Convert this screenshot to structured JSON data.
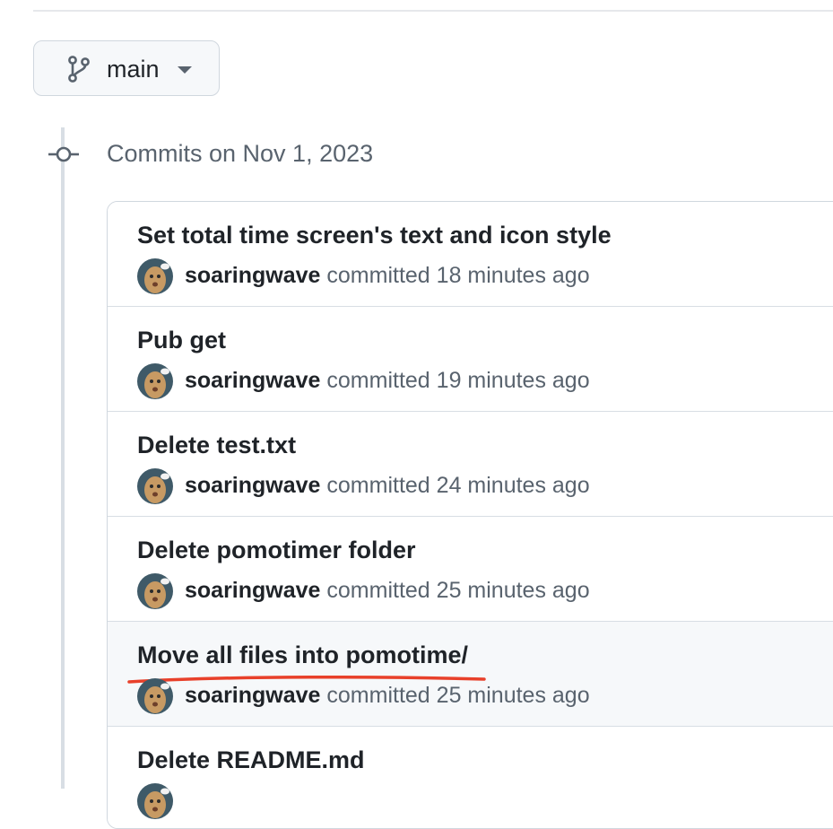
{
  "branch": {
    "name": "main",
    "icon": "git-branch-icon",
    "dropdown_icon": "triangle-down-icon"
  },
  "timeline": {
    "heading": "Commits on Nov 1, 2023",
    "icon": "git-commit-icon"
  },
  "commits": [
    {
      "title": "Set total time screen's text and icon style",
      "author": "soaringwave",
      "action": "committed",
      "time": "18 minutes ago"
    },
    {
      "title": "Pub get",
      "author": "soaringwave",
      "action": "committed",
      "time": "19 minutes ago"
    },
    {
      "title": "Delete test.txt",
      "author": "soaringwave",
      "action": "committed",
      "time": "24 minutes ago"
    },
    {
      "title": "Delete pomotimer folder",
      "author": "soaringwave",
      "action": "committed",
      "time": "25 minutes ago"
    },
    {
      "title": "Move all files into pomotime/",
      "author": "soaringwave",
      "action": "committed",
      "time": "25 minutes ago"
    },
    {
      "title": "Delete README.md",
      "author": "",
      "action": "",
      "time": ""
    }
  ],
  "colors": {
    "accent_underline": "#e8402a",
    "border": "#d0d7de",
    "muted_text": "#59636e",
    "hover_row": "#f6f8fa"
  }
}
